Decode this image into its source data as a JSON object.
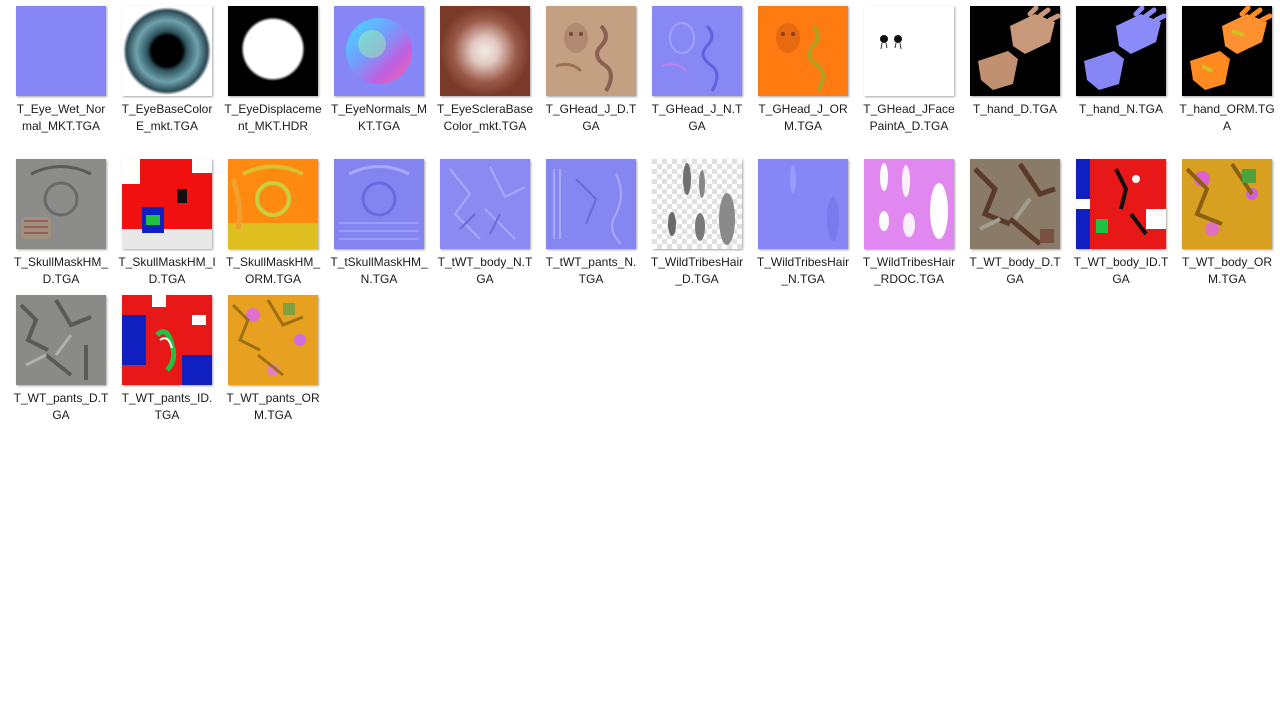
{
  "files": [
    {
      "name": "T_Eye_Wet_Normal_MKT.TGA",
      "thumb": "flat-normal-map"
    },
    {
      "name": "T_EyeBaseColorE_mkt.TGA",
      "thumb": "eye-iris"
    },
    {
      "name": "T_EyeDisplacement_MKT.HDR",
      "thumb": "white-disc-on-black"
    },
    {
      "name": "T_EyeNormals_MKT.TGA",
      "thumb": "normal-sphere"
    },
    {
      "name": "T_EyeScleraBaseColor_mkt.TGA",
      "thumb": "sclera-blur"
    },
    {
      "name": "T_GHead_J_D.TGA",
      "thumb": "head-diffuse"
    },
    {
      "name": "T_GHead_J_N.TGA",
      "thumb": "head-normal"
    },
    {
      "name": "T_GHead_J_ORM.TGA",
      "thumb": "head-orm"
    },
    {
      "name": "T_GHead_JFacePaintA_D.TGA",
      "thumb": "facepaint-mask"
    },
    {
      "name": "T_hand_D.TGA",
      "thumb": "hand-diffuse"
    },
    {
      "name": "T_hand_N.TGA",
      "thumb": "hand-normal"
    },
    {
      "name": "T_hand_ORM.TGA",
      "thumb": "hand-orm"
    },
    {
      "name": "T_SkullMaskHM_D.TGA",
      "thumb": "skullmask-diffuse"
    },
    {
      "name": "T_SkullMaskHM_ID.TGA",
      "thumb": "skullmask-id"
    },
    {
      "name": "T_SkullMaskHM_ORM.TGA",
      "thumb": "skullmask-orm"
    },
    {
      "name": "T_tSkullMaskHM_N.TGA",
      "thumb": "skullmask-normal"
    },
    {
      "name": "T_tWT_body_N.TGA",
      "thumb": "body-normal"
    },
    {
      "name": "T_tWT_pants_N.TGA",
      "thumb": "pants-normal"
    },
    {
      "name": "T_WildTribesHair_D.TGA",
      "thumb": "hair-diffuse"
    },
    {
      "name": "T_WildTribesHair_N.TGA",
      "thumb": "hair-normal"
    },
    {
      "name": "T_WildTribesHair_RDOC.TGA",
      "thumb": "hair-rdoc"
    },
    {
      "name": "T_WT_body_D.TGA",
      "thumb": "body-diffuse"
    },
    {
      "name": "T_WT_body_ID.TGA",
      "thumb": "body-id"
    },
    {
      "name": "T_WT_body_ORM.TGA",
      "thumb": "body-orm"
    },
    {
      "name": "T_WT_pants_D.TGA",
      "thumb": "pants-diffuse"
    },
    {
      "name": "T_WT_pants_ID.TGA",
      "thumb": "pants-id"
    },
    {
      "name": "T_WT_pants_ORM.TGA",
      "thumb": "pants-orm"
    }
  ],
  "colors": {
    "normal_blue": "#8080f8",
    "orm_orange": "#ff7a00",
    "id_red": "#f01010",
    "id_blue": "#1020d0",
    "hair_pink": "#e080f0",
    "skin_tan": "#c09878"
  }
}
